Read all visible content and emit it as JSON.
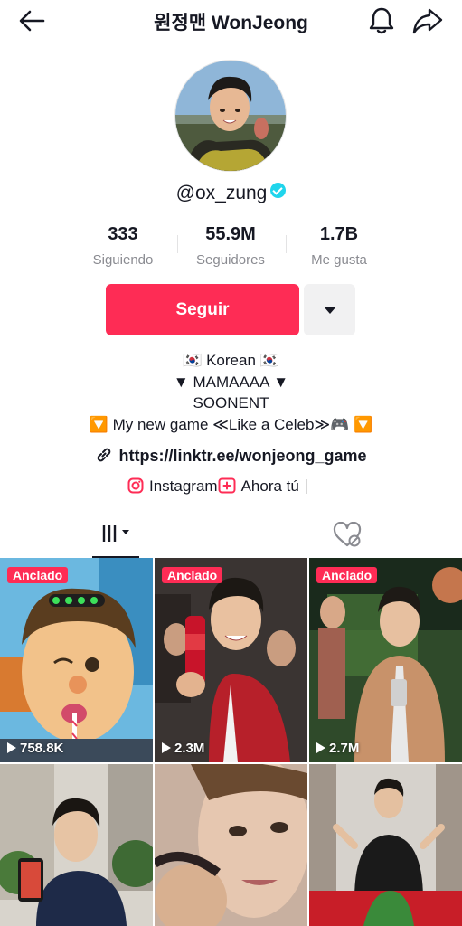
{
  "header": {
    "title": "원정맨 WonJeong"
  },
  "profile": {
    "username": "@ox_zung"
  },
  "stats": {
    "following": {
      "value": "333",
      "label": "Siguiendo"
    },
    "followers": {
      "value": "55.9M",
      "label": "Seguidores"
    },
    "likes": {
      "value": "1.7B",
      "label": "Me gusta"
    }
  },
  "actions": {
    "follow_label": "Seguir"
  },
  "bio": {
    "line1": "🇰🇷 Korean 🇰🇷",
    "line2": "▼ MAMAAAA ▼",
    "line3": "SOONENT",
    "line4": "🔽 My new game ≪Like a Celeb≫🎮 🔽"
  },
  "link": {
    "url": "https://linktr.ee/wonjeong_game"
  },
  "social": {
    "instagram": "Instagram",
    "now_you": "Ahora tú"
  },
  "grid": {
    "items": [
      {
        "pinned": "Anclado",
        "views": "758.8K"
      },
      {
        "pinned": "Anclado",
        "views": "2.3M"
      },
      {
        "pinned": "Anclado",
        "views": "2.7M"
      },
      {
        "pinned": "",
        "views": ""
      },
      {
        "pinned": "",
        "views": ""
      },
      {
        "pinned": "",
        "views": ""
      }
    ]
  },
  "colors": {
    "accent": "#fe2c55",
    "verified": "#20d5ec",
    "text": "#161823",
    "muted": "#8a8b91"
  }
}
